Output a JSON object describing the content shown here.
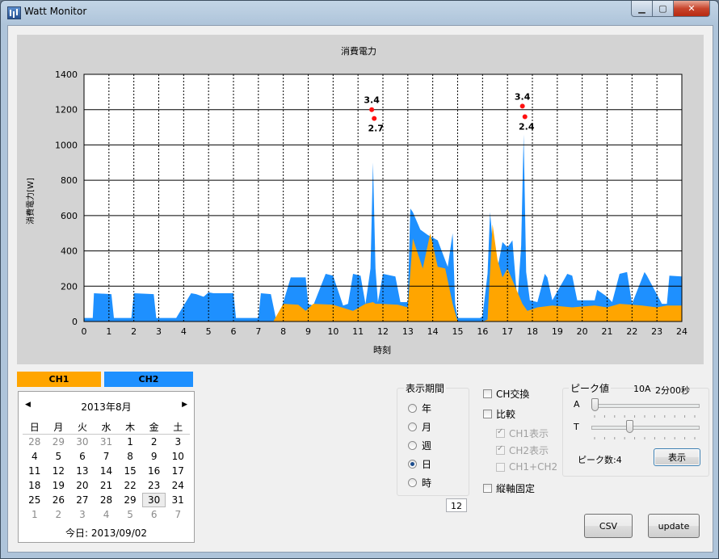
{
  "window": {
    "title": "Watt Monitor"
  },
  "chart_data": {
    "type": "area",
    "title": "消費電力",
    "xlabel": "時刻",
    "ylabel": "消費電力[W]",
    "xlim": [
      0,
      24
    ],
    "ylim": [
      0,
      1400
    ],
    "xticks": [
      0,
      1,
      2,
      3,
      4,
      5,
      6,
      7,
      8,
      9,
      10,
      11,
      12,
      13,
      14,
      15,
      16,
      17,
      18,
      19,
      20,
      21,
      22,
      23,
      24
    ],
    "yticks": [
      0,
      200,
      400,
      600,
      800,
      1000,
      1200,
      1400
    ],
    "grid": true,
    "series": [
      {
        "name": "CH2",
        "color": "#1e90ff",
        "x": [
          0,
          0.35,
          0.4,
          1.1,
          1.2,
          1.9,
          2.0,
          2.8,
          2.9,
          3.6,
          3.7,
          4.3,
          4.5,
          4.8,
          5.0,
          5.2,
          6.0,
          6.1,
          7.0,
          7.1,
          7.5,
          7.7,
          7.8,
          8.0,
          8.3,
          8.9,
          9.0,
          9.2,
          9.7,
          10.0,
          10.4,
          10.6,
          10.8,
          11.1,
          11.3,
          11.5,
          11.6,
          11.7,
          11.8,
          12.0,
          12.5,
          12.7,
          13.0,
          13.1,
          13.2,
          13.5,
          13.8,
          14.2,
          14.6,
          14.8,
          14.9,
          15.0,
          15.2,
          15.5,
          15.9,
          16.0,
          16.2,
          16.3,
          16.4,
          16.6,
          16.8,
          17.0,
          17.2,
          17.4,
          17.55,
          17.65,
          17.75,
          17.9,
          18.2,
          18.5,
          18.6,
          18.8,
          19.4,
          19.6,
          19.8,
          20.5,
          20.6,
          21.0,
          21.2,
          21.5,
          21.8,
          22.0,
          22.5,
          22.6,
          23.2,
          23.4,
          23.5,
          24.0
        ],
        "y": [
          20,
          20,
          160,
          155,
          20,
          20,
          160,
          155,
          20,
          20,
          20,
          160,
          155,
          140,
          165,
          160,
          160,
          20,
          20,
          160,
          155,
          20,
          20,
          110,
          250,
          250,
          100,
          90,
          270,
          260,
          90,
          100,
          270,
          260,
          100,
          300,
          900,
          300,
          110,
          270,
          255,
          110,
          110,
          640,
          620,
          520,
          490,
          460,
          310,
          500,
          100,
          20,
          20,
          20,
          20,
          30,
          270,
          620,
          460,
          300,
          450,
          420,
          460,
          110,
          430,
          1060,
          280,
          120,
          110,
          270,
          250,
          120,
          270,
          260,
          120,
          120,
          180,
          140,
          110,
          270,
          280,
          100,
          280,
          260,
          100,
          100,
          260,
          255
        ],
        "peaks": [
          {
            "x": 11.65,
            "label": "2.7",
            "value": 1150
          },
          {
            "x": 17.7,
            "label": "2.4",
            "value": 1160
          }
        ]
      },
      {
        "name": "CH1",
        "color": "#ffa500",
        "x": [
          0,
          7.5,
          7.6,
          8.0,
          8.6,
          8.9,
          9.2,
          10.0,
          10.8,
          11.3,
          11.6,
          11.7,
          11.9,
          12.6,
          13.0,
          13.2,
          13.6,
          13.9,
          14.2,
          14.5,
          14.8,
          15.0,
          16.0,
          16.2,
          16.4,
          16.6,
          16.8,
          17.0,
          17.3,
          17.6,
          17.8,
          18.2,
          18.8,
          19.6,
          20.5,
          21.0,
          21.5,
          22.4,
          23.0,
          23.4,
          24.0
        ],
        "y": [
          0,
          0,
          0,
          100,
          95,
          60,
          100,
          95,
          60,
          100,
          110,
          100,
          100,
          95,
          80,
          470,
          300,
          500,
          310,
          300,
          100,
          0,
          0,
          10,
          550,
          350,
          250,
          300,
          200,
          100,
          60,
          80,
          90,
          80,
          90,
          80,
          100,
          90,
          80,
          90,
          90
        ],
        "peaks": [
          {
            "x": 11.55,
            "label": "3.4",
            "value": 1200
          },
          {
            "x": 17.6,
            "label": "3.4",
            "value": 1220
          }
        ]
      }
    ]
  },
  "legend": {
    "ch1": "CH1",
    "ch2": "CH2",
    "ch1_color": "#ffa500",
    "ch2_color": "#1e90ff"
  },
  "calendar": {
    "month_label": "2013年8月",
    "prev": "◀",
    "next": "▶",
    "weekdays": [
      "日",
      "月",
      "火",
      "水",
      "木",
      "金",
      "土"
    ],
    "weeks": [
      [
        "28",
        "29",
        "30",
        "31",
        "1",
        "2",
        "3"
      ],
      [
        "4",
        "5",
        "6",
        "7",
        "8",
        "9",
        "10"
      ],
      [
        "11",
        "12",
        "13",
        "14",
        "15",
        "16",
        "17"
      ],
      [
        "18",
        "19",
        "20",
        "21",
        "22",
        "23",
        "24"
      ],
      [
        "25",
        "26",
        "27",
        "28",
        "29",
        "30",
        "31"
      ],
      [
        "1",
        "2",
        "3",
        "4",
        "5",
        "6",
        "7"
      ]
    ],
    "selected": "30",
    "today_label": "今日: 2013/09/02"
  },
  "period": {
    "label": "表示期間",
    "options": [
      "年",
      "月",
      "週",
      "日",
      "時"
    ],
    "selected": "日",
    "hour_value": "12"
  },
  "options": {
    "ch_swap": "CH交換",
    "compare": "比較",
    "ch1_show": "CH1表示",
    "ch2_show": "CH2表示",
    "ch1_plus_ch2": "CH1+CH2",
    "fixed_axis": "縦軸固定"
  },
  "peak": {
    "label": "ピーク値",
    "value_text": "10A",
    "time_text": "2分00秒",
    "a_label": "A",
    "t_label": "T",
    "a_level": 0.0,
    "t_level": 0.35,
    "count_text": "ピーク数:4",
    "show_button": "表示"
  },
  "buttons": {
    "csv": "CSV",
    "update": "update"
  }
}
